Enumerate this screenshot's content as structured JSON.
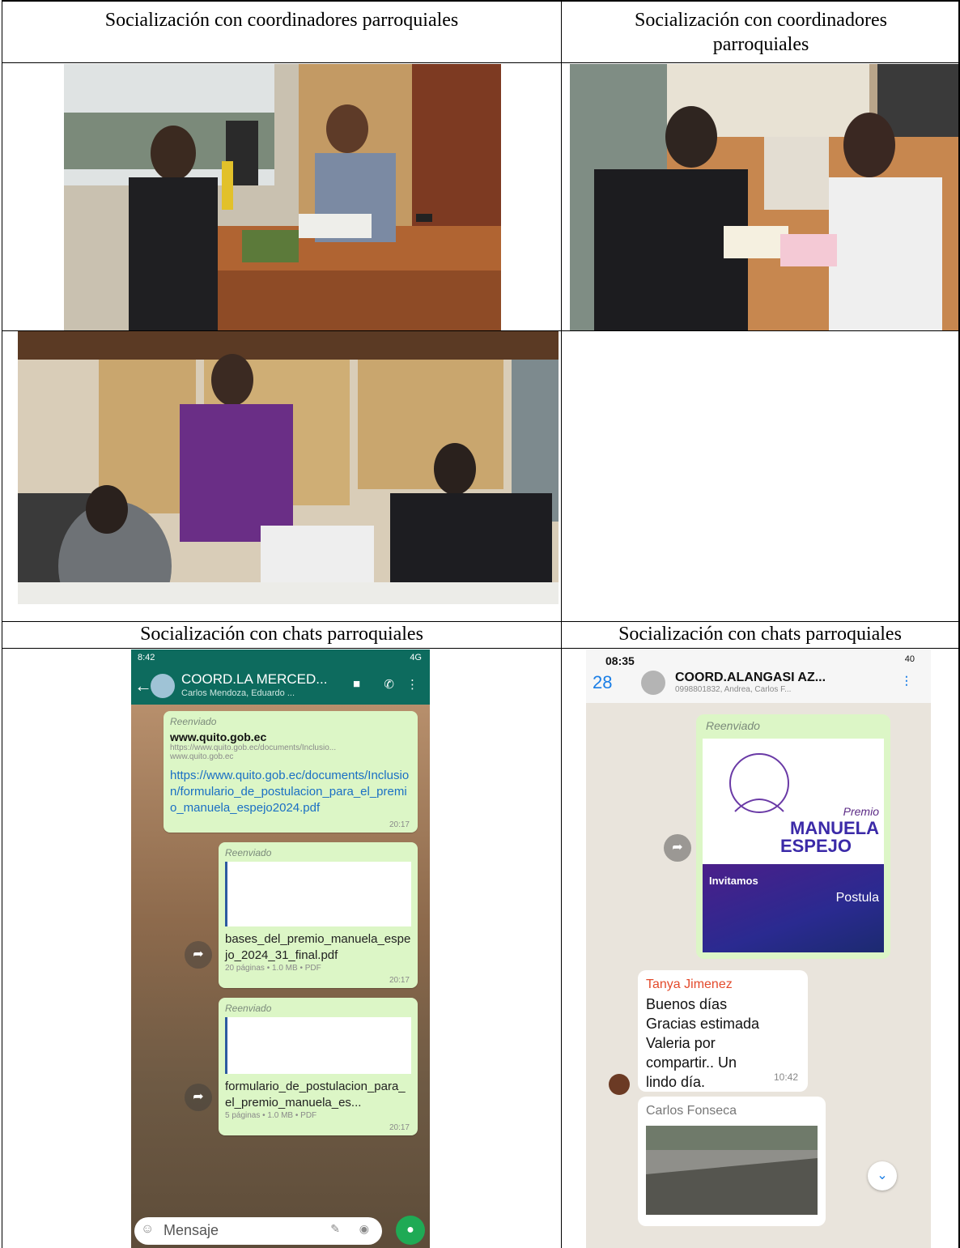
{
  "captions": {
    "row1_left": "Socialización con coordinadores parroquiales",
    "row1_right": "Socialización con coordinadores parroquiales",
    "row3_left": "Socialización con chats parroquiales",
    "row3_right": "Socialización con chats parroquiales"
  },
  "chat_left": {
    "status_time": "8:42",
    "status_right": "4G",
    "group_name": "COORD.LA MERCED...",
    "group_members": "Carlos Mendoza, Eduardo ...",
    "forwarded_label": "Reenviado",
    "msg1": {
      "title": "www.quito.gob.ec",
      "preview_line1": "https://www.quito.gob.ec/documents/Inclusio...",
      "preview_line2": "www.quito.gob.ec",
      "link": "https://www.quito.gob.ec/documents/Inclusion/formulario_de_postulacion_para_el_premio_manuela_espejo2024.pdf",
      "time": "20:17"
    },
    "msg2": {
      "file": "bases_del_premio_manuela_espejo_2024_31_final.pdf",
      "meta": "20 páginas • 1.0 MB • PDF",
      "time": "20:17"
    },
    "msg3": {
      "file": "formulario_de_postulacion_para_el_premio_manuela_es...",
      "meta": "5 páginas • 1.0 MB • PDF",
      "time": "20:17"
    },
    "input_placeholder": "Mensaje"
  },
  "chat_right": {
    "status_time": "08:35",
    "status_right": "40",
    "back_count": "28",
    "group_name": "COORD.ALANGASI AZ...",
    "group_members": "0998801832, Andrea, Carlos F...",
    "forwarded_label": "Reenviado",
    "poster": {
      "line1": "Premio",
      "line2": "MANUELA",
      "line3": "ESPEJO",
      "invite": "Invitamos",
      "postula": "Postula"
    },
    "msg1": {
      "author": "Tanya Jimenez",
      "text": "Buenos días Gracias estimada Valeria por compartir.. Un lindo día.",
      "time": "10:42"
    },
    "msg2": {
      "author": "Carlos Fonseca"
    }
  }
}
